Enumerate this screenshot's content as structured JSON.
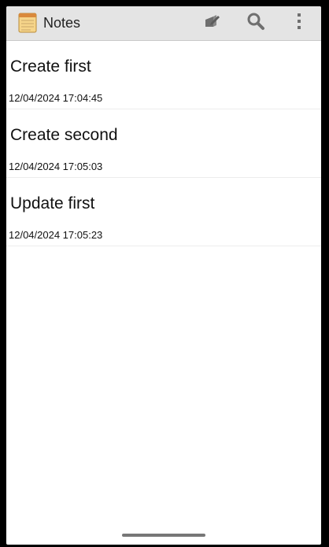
{
  "app": {
    "title": "Notes",
    "icon": "notepad-icon"
  },
  "action_bar": {
    "actions": [
      {
        "name": "new-note",
        "icon": "compose-icon"
      },
      {
        "name": "search",
        "icon": "search-icon"
      },
      {
        "name": "more-options",
        "icon": "overflow-menu-icon"
      }
    ]
  },
  "notes": [
    {
      "title": "Create first",
      "date": "12/04/2024 17:04:45"
    },
    {
      "title": "Create second",
      "date": "12/04/2024 17:05:03"
    },
    {
      "title": "Update first",
      "date": "12/04/2024 17:05:23"
    }
  ],
  "colors": {
    "action_bar_bg": "#e4e4e4",
    "icon_gray": "#6f6f6f",
    "notepad_yellow": "#f6d58a"
  }
}
